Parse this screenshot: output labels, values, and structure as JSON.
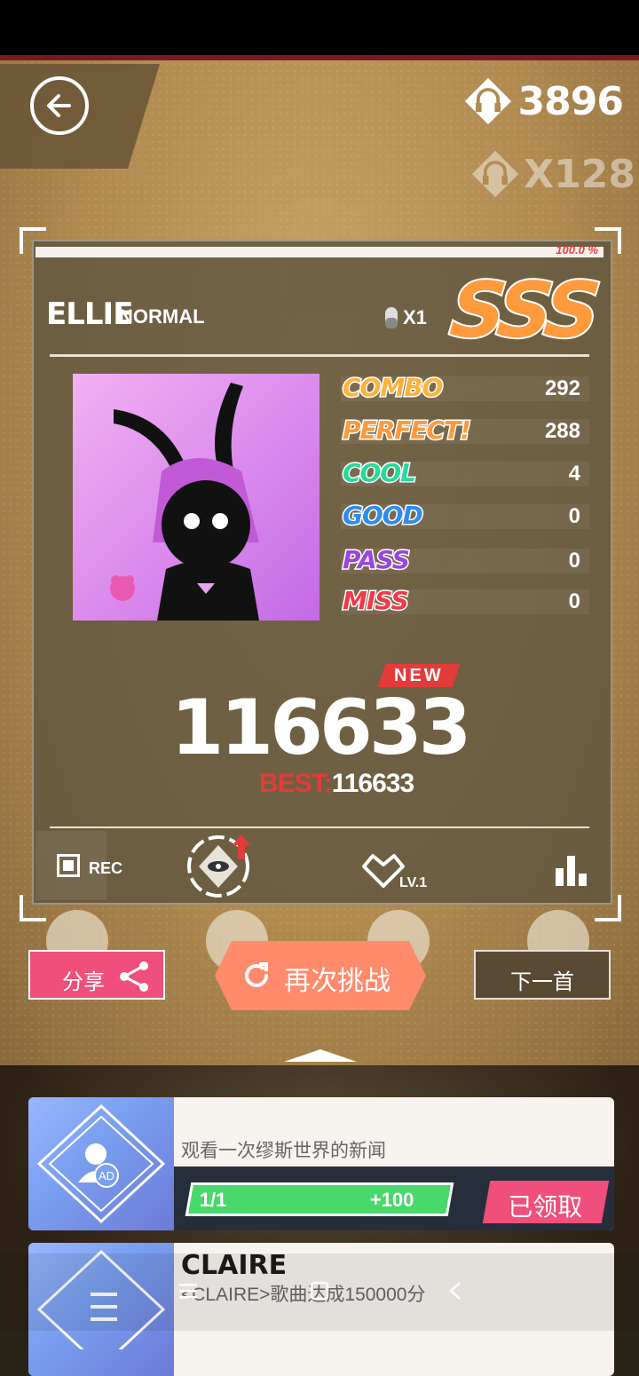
{
  "header": {
    "currency": "3896",
    "multiplier": "X128",
    "back_icon": "back-arrow-icon"
  },
  "result": {
    "progress_label": "100.0 %",
    "progress_percent": 100,
    "song": "ELLIE",
    "difficulty": "NORMAL",
    "lives": "X1",
    "grade": "SSS",
    "stats": [
      {
        "label": "COMBO",
        "value": "292",
        "color": "#ffb13a"
      },
      {
        "label": "PERFECT!",
        "value": "288",
        "color": "#ff9a3c"
      },
      {
        "label": "COOL",
        "value": "4",
        "color": "#27d99a"
      },
      {
        "label": "GOOD",
        "value": "0",
        "color": "#2d8df0"
      },
      {
        "label": "PASS",
        "value": "0",
        "color": "#9b45e0"
      },
      {
        "label": "MISS",
        "value": "0",
        "color": "#f2384b"
      }
    ],
    "new_badge": "NEW",
    "score": "116633",
    "best_label": "BEST:",
    "best_value": "116633"
  },
  "toolbar": {
    "rec_label": "REC",
    "level_label": "LV.1"
  },
  "actions": {
    "share": "分享",
    "retry": "再次挑战",
    "next": "下一首"
  },
  "tasks": [
    {
      "desc": "观看一次缪斯世界的新闻",
      "progress": "1/1",
      "reward": "+100",
      "claim": "已领取"
    },
    {
      "title": "CLAIRE",
      "desc": "<CLAIRE>歌曲达成150000分"
    }
  ],
  "colors": {
    "accent_pink": "#ef4f7a",
    "retry_orange": "#ff8a6c",
    "best_red": "#e23b3b"
  }
}
